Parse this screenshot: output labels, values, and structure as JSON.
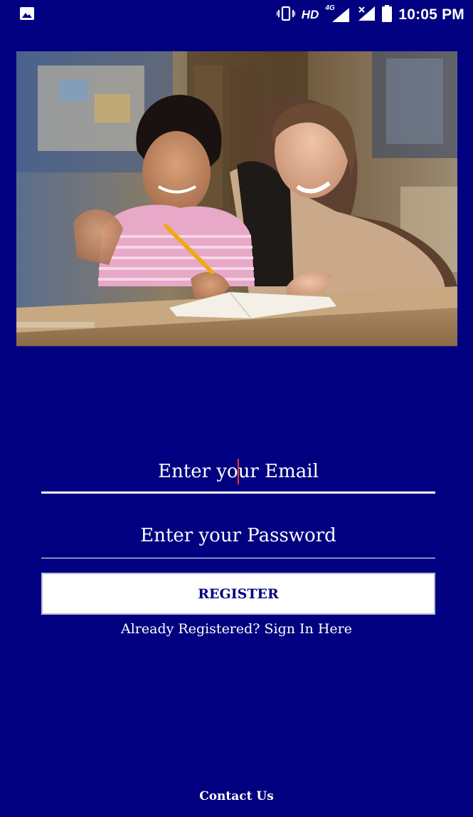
{
  "status_bar": {
    "left_icon": "image-notification-icon",
    "hd_label": "HD",
    "network_label": "4G",
    "time": "10:05 PM"
  },
  "hero": {
    "icon": "teacher-student-photo"
  },
  "form": {
    "email_placeholder": "Enter your Email",
    "password_placeholder": "Enter your Password",
    "register_label": "REGISTER",
    "signin_label": "Already Registered? Sign In Here"
  },
  "footer": {
    "contact_label": "Contact Us"
  },
  "colors": {
    "background": "#000080",
    "button_background": "#ffffff",
    "button_text": "#000080",
    "cursor": "#e53935"
  }
}
